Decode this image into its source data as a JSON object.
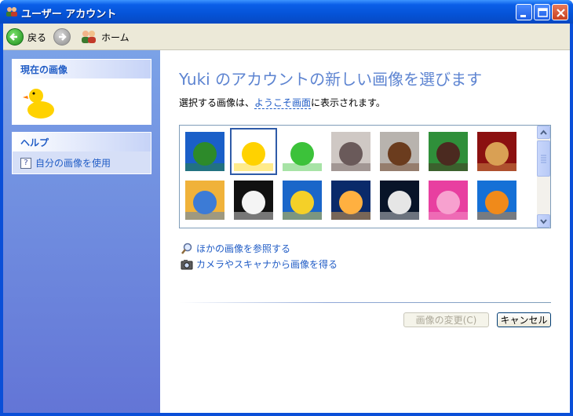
{
  "window": {
    "title": "ユーザー アカウント"
  },
  "toolbar": {
    "back_label": "戻る",
    "home_label": "ホーム"
  },
  "sidebar": {
    "current_panel": {
      "title": "現在の画像"
    },
    "help_panel": {
      "title": "ヘルプ",
      "link": "自分の画像を使用"
    }
  },
  "main": {
    "heading": "Yuki のアカウントの新しい画像を選びます",
    "sub_prefix": "選択する画像は、",
    "sub_link": "ようこそ画面",
    "sub_suffix": "に表示されます。",
    "browse_link": "ほかの画像を参照する",
    "camera_link": "カメラやスキャナから画像を得る",
    "change_button": "画像の変更(C)",
    "cancel_button": "キャンセル",
    "selected_picture": "duck"
  },
  "pictures": [
    {
      "name": "palm-trees",
      "colors": [
        "#1a5fc8",
        "#2d8a2a"
      ]
    },
    {
      "name": "duck",
      "colors": [
        "#ffffff",
        "#ffd200"
      ]
    },
    {
      "name": "frog",
      "colors": [
        "#ffffff",
        "#3cc23a"
      ]
    },
    {
      "name": "karate",
      "colors": [
        "#cfc8c4",
        "#6a5a5a"
      ]
    },
    {
      "name": "guitar",
      "colors": [
        "#b8b3ae",
        "#6b3c1e"
      ]
    },
    {
      "name": "skateboarder",
      "colors": [
        "#2f8f3a",
        "#4b2a20"
      ]
    },
    {
      "name": "chess",
      "colors": [
        "#8b1010",
        "#d9a054"
      ]
    },
    {
      "name": "beach-chairs",
      "colors": [
        "#f0b23a",
        "#3c7bd6"
      ]
    },
    {
      "name": "soccer-ball",
      "colors": [
        "#111111",
        "#f4f4f4"
      ]
    },
    {
      "name": "dirt-bike",
      "colors": [
        "#1a66c9",
        "#f4d028"
      ]
    },
    {
      "name": "space-shuttle",
      "colors": [
        "#0a2a6a",
        "#ffb040"
      ]
    },
    {
      "name": "astronaut",
      "colors": [
        "#081428",
        "#e6e6e6"
      ]
    },
    {
      "name": "flower",
      "colors": [
        "#e83fa0",
        "#f7a1cf"
      ]
    },
    {
      "name": "fish",
      "colors": [
        "#1570d6",
        "#f08a1a"
      ]
    }
  ]
}
